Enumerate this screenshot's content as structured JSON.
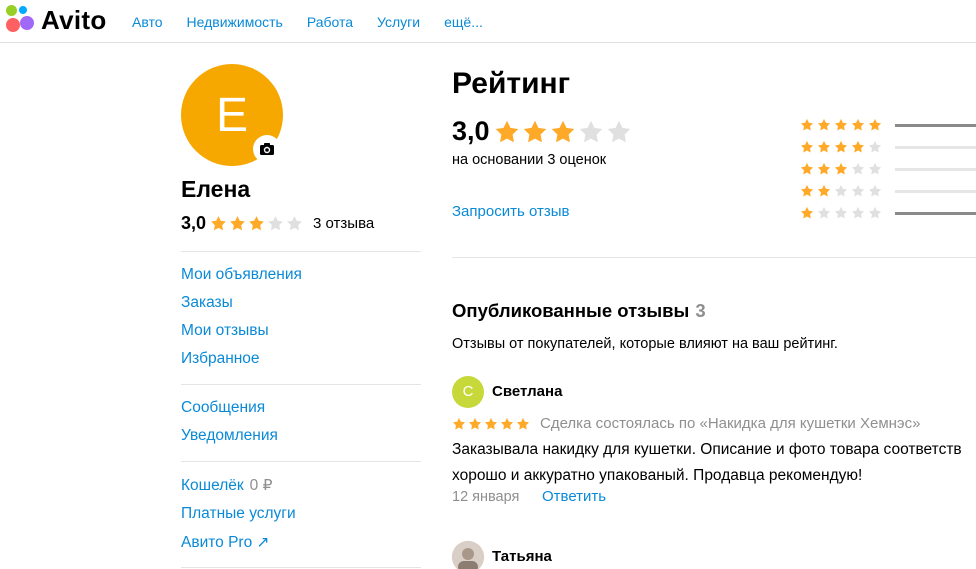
{
  "header": {
    "logo_text": "Avito",
    "nav": [
      "Авто",
      "Недвижимость",
      "Работа",
      "Услуги",
      "ещё..."
    ]
  },
  "profile": {
    "avatar_letter": "Е",
    "avatar_color": "#f6a800",
    "name": "Елена",
    "rating": "3,0",
    "rating_value": 3,
    "reviews_count": "3 отзыва",
    "menu_group1": [
      "Мои объявления",
      "Заказы",
      "Мои отзывы",
      "Избранное"
    ],
    "menu_group2": [
      "Сообщения",
      "Уведомления"
    ],
    "wallet_label": "Кошелёк",
    "wallet_value": "0 ₽",
    "paid_services": "Платные услуги",
    "avito_pro": "Авито Pro ↗"
  },
  "rating": {
    "title": "Рейтинг",
    "score": "3,0",
    "score_value": 3,
    "based_on": "на основании 3 оценок",
    "request_link": "Запросить отзыв",
    "distribution": [
      {
        "stars": 5,
        "fill": 1.0
      },
      {
        "stars": 4,
        "fill": 0.0
      },
      {
        "stars": 3,
        "fill": 0.0
      },
      {
        "stars": 2,
        "fill": 0.0
      },
      {
        "stars": 1,
        "fill": 1.0
      }
    ]
  },
  "reviews": {
    "title": "Опубликованные отзывы",
    "count": "3",
    "subtitle": "Отзывы от покупателей, которые влияют на ваш рейтинг.",
    "items": [
      {
        "avatar_letter": "С",
        "avatar_color": "#c6d83a",
        "name": "Светлана",
        "stars": 5,
        "deal": "Сделка состоялась по «Накидка для кушетки Хемнэс»",
        "text_line1": "Заказывала накидку для кушетки. Описание и фото товара соответств",
        "text_line2": "хорошо и аккуратно упакованый. Продавца рекомендую!",
        "date": "12 января",
        "reply": "Ответить"
      },
      {
        "avatar_letter": "",
        "avatar_color": "#c9b8aa",
        "name": "Татьяна"
      }
    ]
  },
  "colors": {
    "accent": "#0a8ad6",
    "star_on": "#ffa929",
    "star_off": "#e0e0e0"
  }
}
